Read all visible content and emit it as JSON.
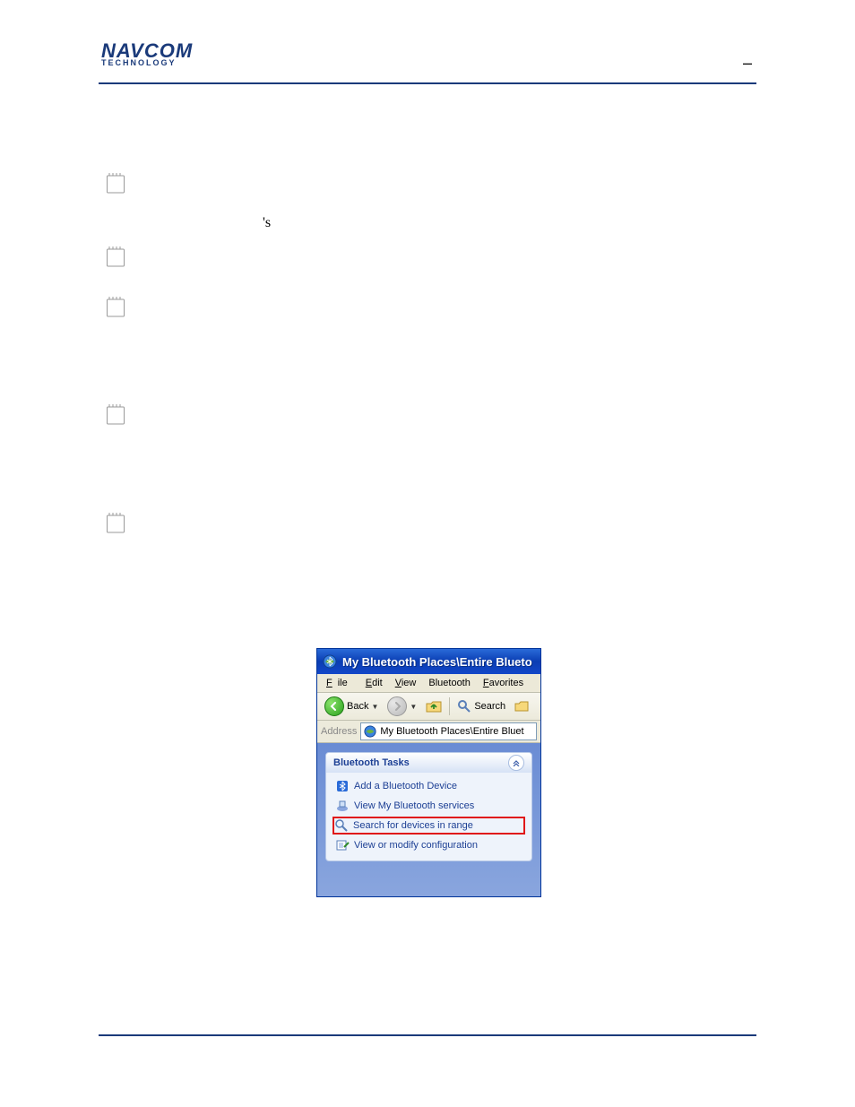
{
  "header": {
    "logo_main": "NAVCOM",
    "logo_sub": "TECHNOLOGY"
  },
  "apostrophe": "'s",
  "xp": {
    "title": "My Bluetooth Places\\Entire Blueto",
    "menu": {
      "file": "File",
      "edit": "Edit",
      "view": "View",
      "bluetooth": "Bluetooth",
      "favorites": "Favorites"
    },
    "toolbar": {
      "back": "Back",
      "search": "Search"
    },
    "address": {
      "label": "Address",
      "value": "My Bluetooth Places\\Entire Bluet"
    },
    "tasks": {
      "header": "Bluetooth Tasks",
      "items": [
        "Add a Bluetooth Device",
        "View My Bluetooth services",
        "Search for devices in range",
        "View or modify configuration"
      ]
    }
  }
}
